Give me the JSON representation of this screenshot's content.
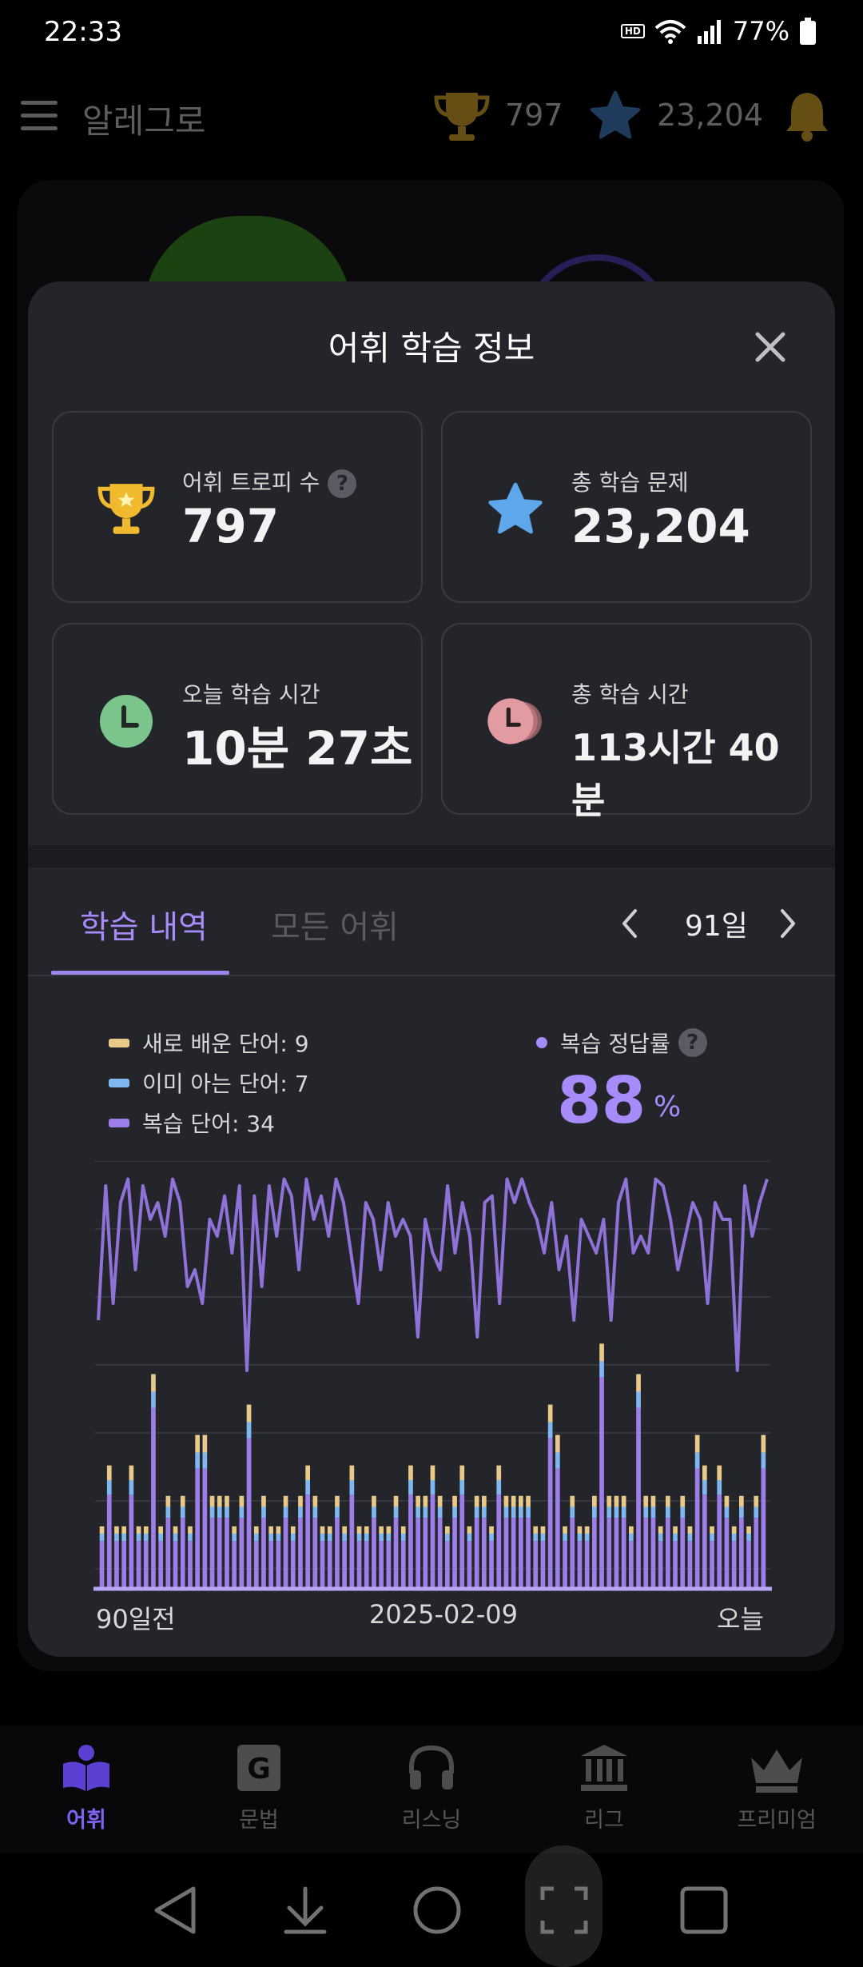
{
  "status": {
    "time": "22:33",
    "hd_badge": "HD",
    "battery": "77%"
  },
  "header": {
    "title": "알레그로",
    "trophies": "797",
    "stars": "23,204"
  },
  "modal": {
    "title": "어휘 학습 정보",
    "stats": {
      "trophy": {
        "label": "어휘 트로피 수",
        "value": "797"
      },
      "total_problems": {
        "label": "총 학습 문제",
        "value": "23,204"
      },
      "today_time": {
        "label": "오늘 학습 시간",
        "value": "10분 27초"
      },
      "total_time": {
        "label": "총 학습 시간",
        "value": "113시간 40분"
      }
    },
    "tabs": [
      {
        "label": "학습 내역"
      },
      {
        "label": "모든 어휘"
      }
    ],
    "period": "91일",
    "legend": [
      {
        "label": "새로 배운 단어: 9",
        "color": "#e8c98a"
      },
      {
        "label": "이미 아는 단어: 7",
        "color": "#7fb8f0"
      },
      {
        "label": "복습 단어: 34",
        "color": "#9d7ee8"
      }
    ],
    "accuracy": {
      "label": "복습 정답률",
      "value": "88",
      "unit": "%"
    },
    "x_labels": {
      "start": "90일전",
      "mid": "2025-02-09",
      "end": "오늘"
    }
  },
  "chart_data": {
    "type": "bar",
    "days": 91,
    "stacked_series": [
      {
        "name": "새로 배운 단어",
        "color": "#e8c98a"
      },
      {
        "name": "이미 아는 단어",
        "color": "#7fb8f0"
      },
      {
        "name": "복습 단어",
        "color": "#9d7ee8"
      }
    ],
    "bar_totals": [
      10,
      20,
      10,
      10,
      20,
      10,
      10,
      35,
      10,
      15,
      10,
      15,
      10,
      25,
      25,
      15,
      15,
      15,
      10,
      15,
      30,
      10,
      15,
      10,
      10,
      15,
      10,
      15,
      20,
      15,
      10,
      10,
      15,
      10,
      20,
      10,
      10,
      15,
      10,
      10,
      15,
      10,
      20,
      15,
      15,
      20,
      15,
      10,
      15,
      20,
      10,
      15,
      15,
      10,
      20,
      15,
      15,
      15,
      15,
      10,
      10,
      30,
      25,
      10,
      15,
      10,
      10,
      15,
      40,
      15,
      15,
      15,
      10,
      35,
      15,
      15,
      10,
      15,
      10,
      15,
      10,
      25,
      20,
      10,
      20,
      15,
      10,
      15,
      10,
      15,
      25
    ],
    "line_series": {
      "name": "복습 정답률",
      "color": "#8f72d8",
      "ylim": [
        0,
        100
      ],
      "values": [
        55,
        95,
        60,
        90,
        97,
        70,
        95,
        85,
        90,
        80,
        97,
        90,
        65,
        70,
        60,
        85,
        80,
        92,
        75,
        95,
        40,
        92,
        65,
        95,
        80,
        97,
        92,
        70,
        97,
        85,
        92,
        80,
        97,
        90,
        75,
        60,
        90,
        85,
        70,
        90,
        80,
        85,
        80,
        50,
        85,
        75,
        70,
        95,
        75,
        90,
        80,
        50,
        90,
        92,
        60,
        97,
        90,
        97,
        90,
        85,
        75,
        90,
        70,
        80,
        55,
        85,
        80,
        75,
        85,
        55,
        90,
        97,
        75,
        80,
        75,
        97,
        95,
        85,
        70,
        80,
        90,
        85,
        60,
        90,
        85,
        85,
        40,
        95,
        80,
        90,
        97
      ]
    }
  }
}
